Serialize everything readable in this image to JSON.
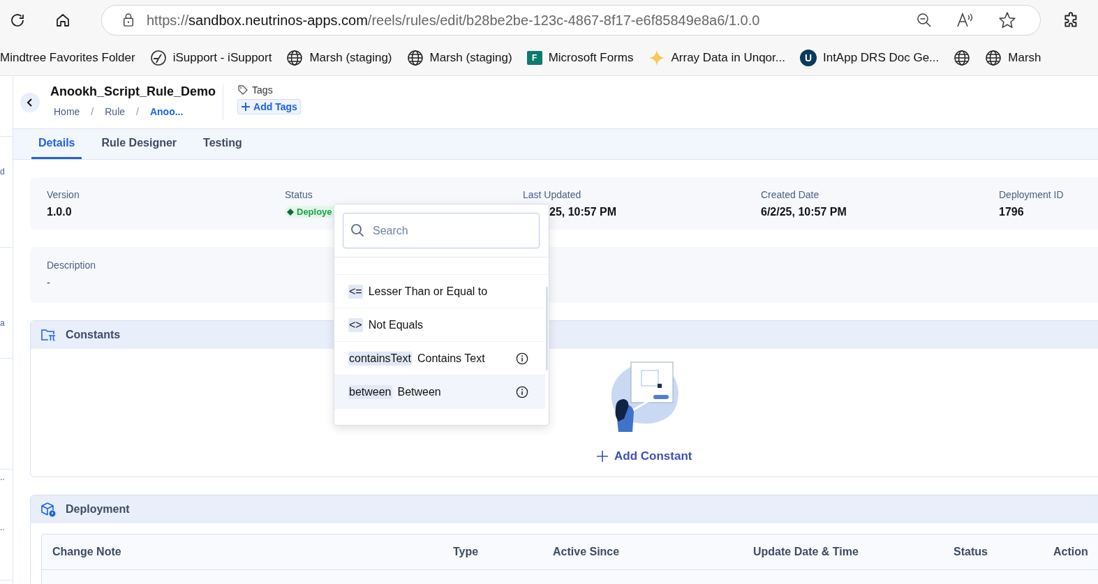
{
  "browser": {
    "url_scheme": "https://",
    "url_host": "sandbox.neutrinos-apps.com",
    "url_path": "/reels/rules/edit/b28be2be-123c-4867-8f17-e6f85849e8a6/1.0.0",
    "bookmarks": [
      {
        "kind": "none",
        "label": "Mindtree Favorites Folder"
      },
      {
        "kind": "logo",
        "label": "iSupport - iSupport"
      },
      {
        "kind": "globe",
        "label": "Marsh (staging)"
      },
      {
        "kind": "globe",
        "label": "Marsh (staging)"
      },
      {
        "kind": "forms",
        "icon_text": "F",
        "label": "Microsoft Forms"
      },
      {
        "kind": "sparkle",
        "label": "Array Data in Unqor..."
      },
      {
        "kind": "letter",
        "icon_text": "U",
        "label": "IntApp DRS Doc Ge..."
      },
      {
        "kind": "globe"
      },
      {
        "kind": "globe",
        "label": "Marsh"
      }
    ]
  },
  "sidebar": {
    "items": [
      {
        "label": "d"
      },
      {
        "label": "a"
      },
      {
        "label": ".."
      },
      {
        "label": ".."
      }
    ]
  },
  "header": {
    "title": "Anookh_Script_Rule_Demo",
    "breadcrumbs": [
      {
        "label": "Home",
        "selected": false
      },
      {
        "label": "Rule",
        "selected": false
      },
      {
        "label": "Anoo...",
        "selected": true
      }
    ],
    "separator": "/",
    "tags_label": "Tags",
    "add_tags": "Add Tags"
  },
  "tabs": [
    {
      "label": "Details",
      "selected": true
    },
    {
      "label": "Rule Designer",
      "selected": false
    },
    {
      "label": "Testing",
      "selected": false
    }
  ],
  "info": [
    {
      "kind": "text",
      "label": "Version",
      "value": "1.0.0"
    },
    {
      "kind": "status",
      "label": "Status",
      "value": "Deploye"
    },
    {
      "kind": "text",
      "label": "Last Updated",
      "value": "25, 10:57 PM"
    },
    {
      "kind": "text",
      "label": "Created Date",
      "value": "6/2/25, 10:57 PM"
    },
    {
      "kind": "text",
      "label": "Deployment ID",
      "value": "1796"
    }
  ],
  "description": {
    "label": "Description",
    "value": "-"
  },
  "constants": {
    "title": "Constants",
    "add_label": "Add Constant"
  },
  "deployment": {
    "title": "Deployment",
    "columns": [
      "Change Note",
      "Type",
      "Active Since",
      "Update Date & Time",
      "Status",
      "Action"
    ]
  },
  "dropdown": {
    "search_placeholder": "Search",
    "options": [
      {
        "code": "<=",
        "label": "Lesser Than or Equal to",
        "info": false,
        "selected": false
      },
      {
        "code": "<>",
        "label": "Not Equals",
        "info": false,
        "selected": false
      },
      {
        "code": "containsText",
        "label": "Contains Text",
        "info": true,
        "selected": false
      },
      {
        "code": "between",
        "label": "Between",
        "info": true,
        "selected": true
      }
    ]
  }
}
